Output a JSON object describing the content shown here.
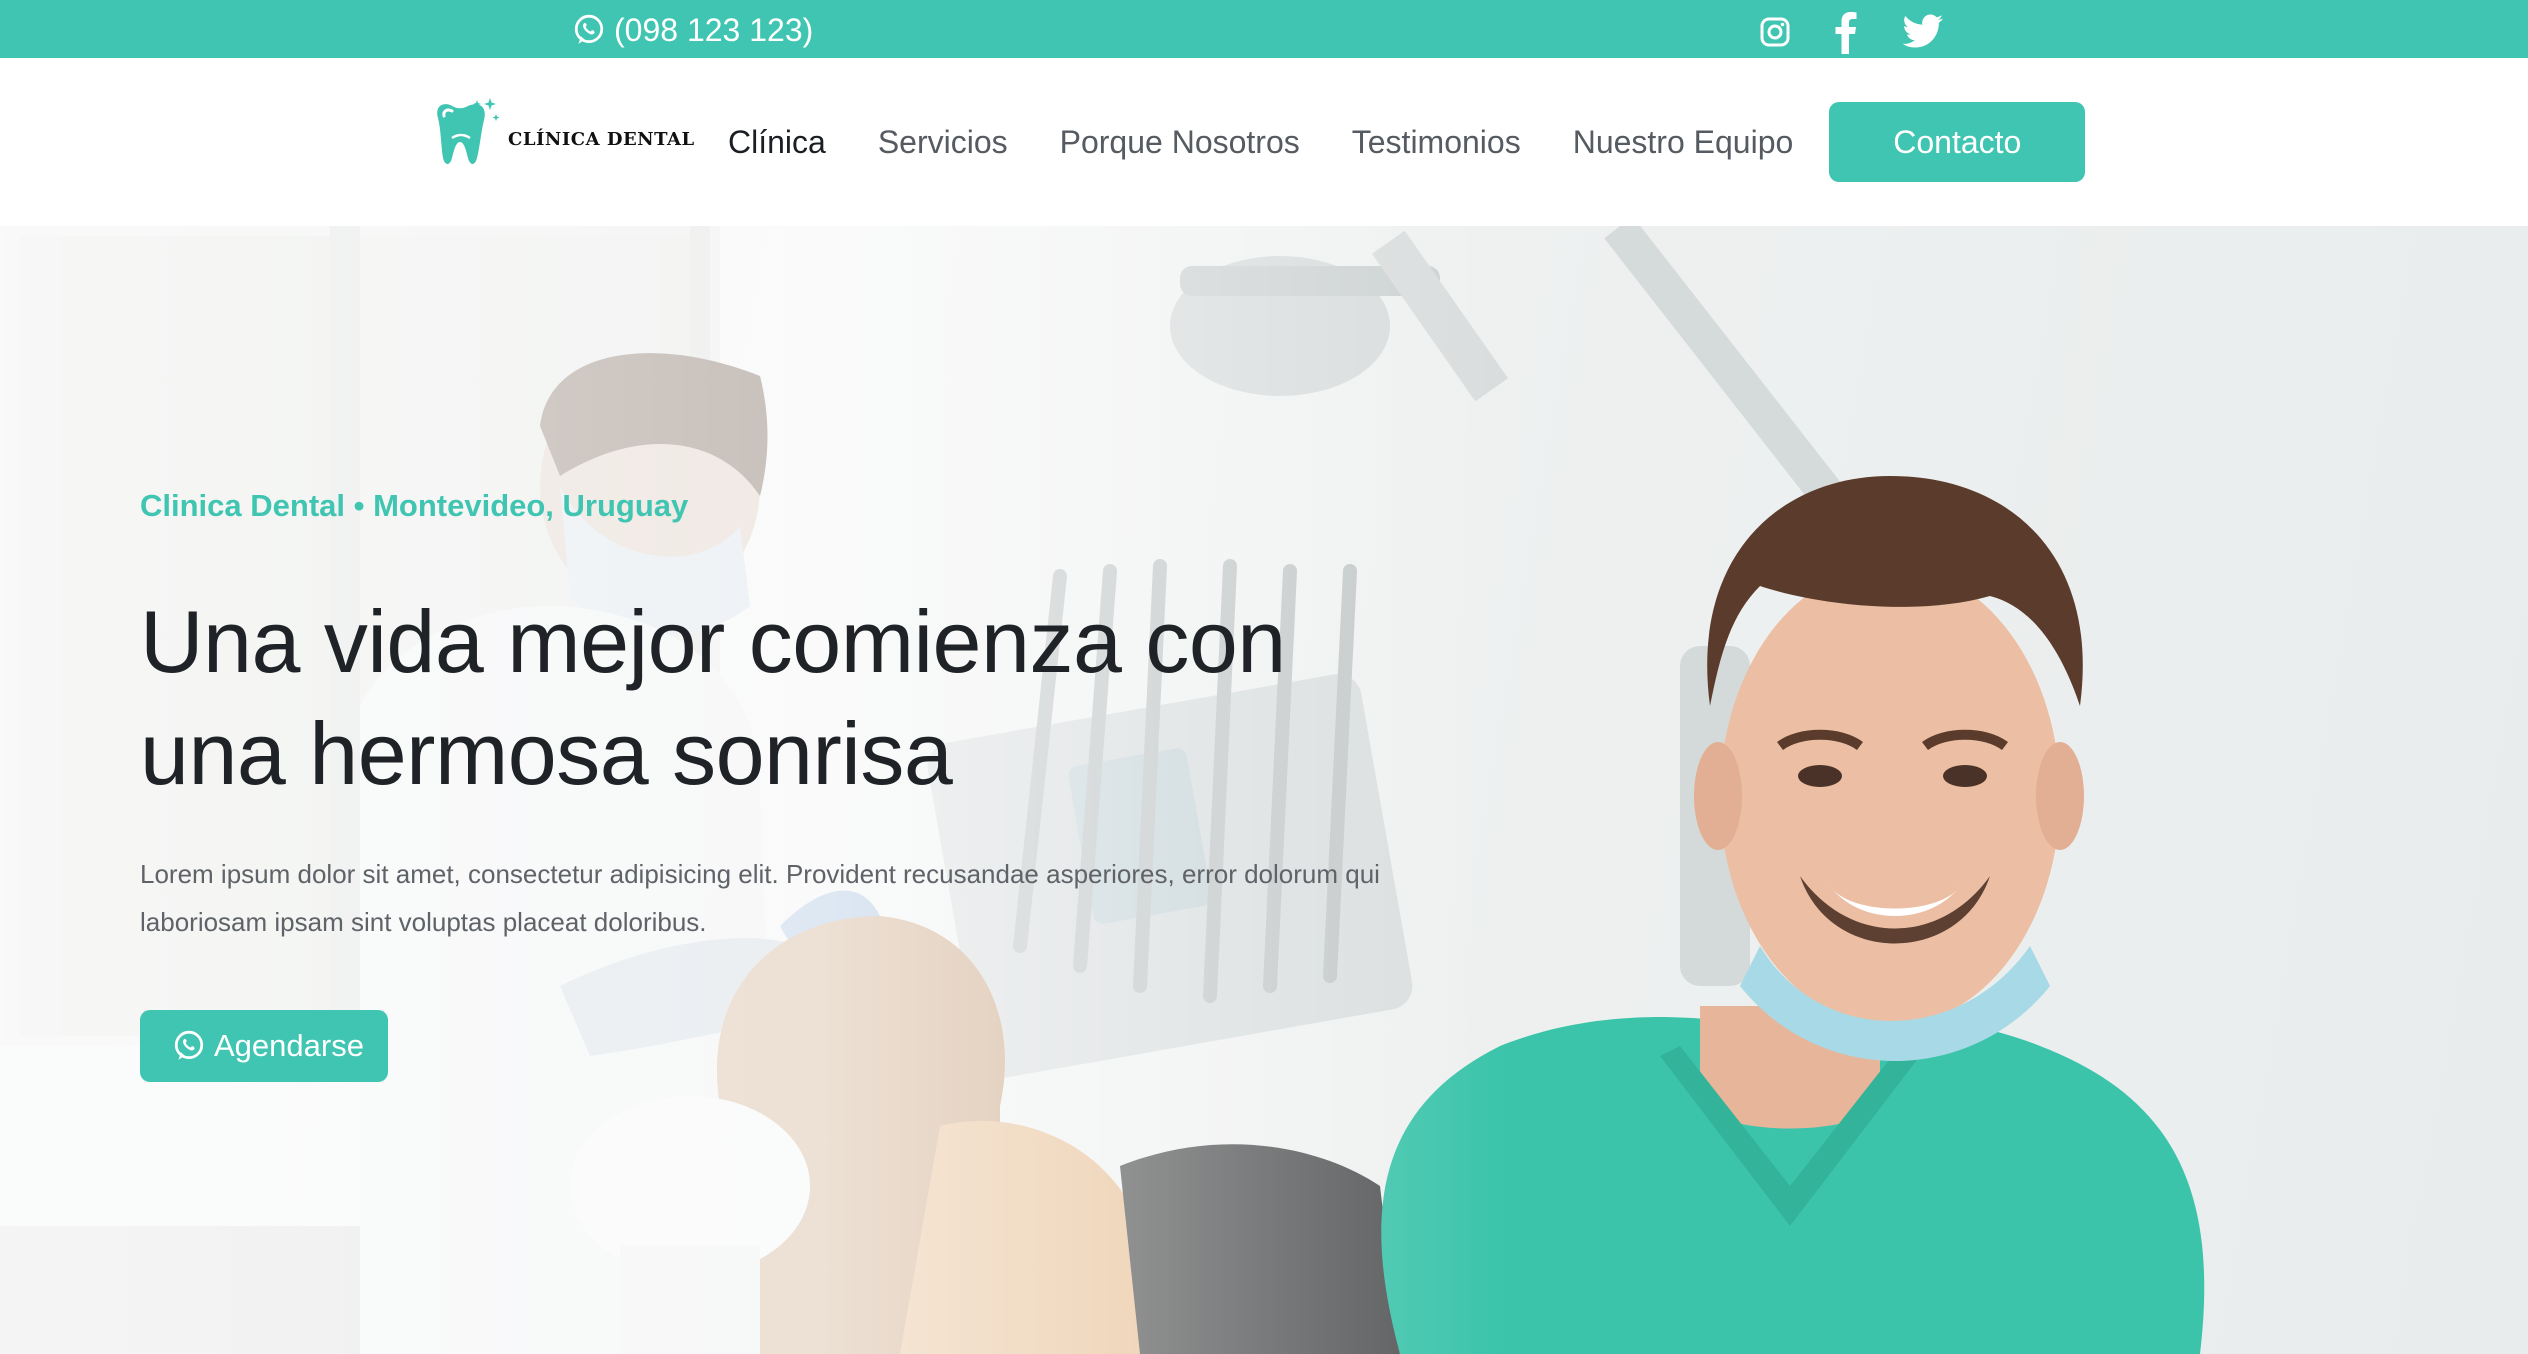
{
  "topbar": {
    "phone": "(098 123 123)",
    "phone_icon": "whatsapp-icon",
    "socials": [
      "instagram-icon",
      "facebook-icon",
      "twitter-icon"
    ]
  },
  "brand": {
    "name": "CLÍNICA DENTAL",
    "logo_icon": "tooth-icon"
  },
  "nav": {
    "items": [
      {
        "label": "Clínica",
        "active": true
      },
      {
        "label": "Servicios"
      },
      {
        "label": "Porque Nosotros"
      },
      {
        "label": "Testimonios"
      },
      {
        "label": "Nuestro Equipo"
      }
    ],
    "contact_label": "Contacto"
  },
  "hero": {
    "kicker": "Clinica Dental • Montevideo, Uruguay",
    "title_line1": "Una vida mejor comienza con",
    "title_line2": "una hermosa sonrisa",
    "lead": "Lorem ipsum dolor sit amet, consectetur adipisicing elit. Provident recusandae asperiores, error dolorum qui laboriosam ipsam sint voluptas placeat doloribus.",
    "cta_label": "Agendarse",
    "cta_icon": "whatsapp-icon"
  },
  "colors": {
    "accent": "#3fc5b1",
    "heading": "#1f2226",
    "body_text": "#5f6368",
    "scrubs": "#3cc4aa"
  }
}
